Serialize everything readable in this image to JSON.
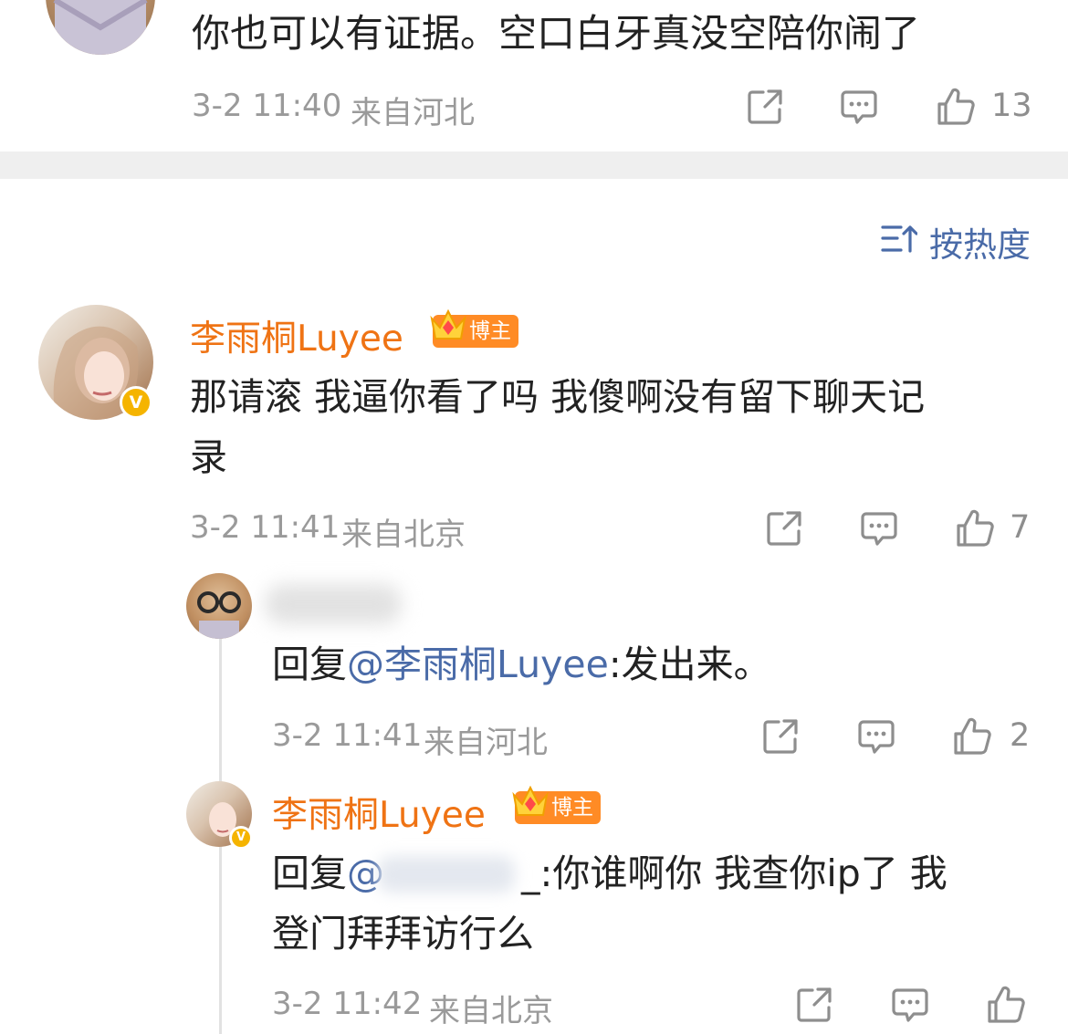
{
  "colors": {
    "accent": "#ef7314",
    "mention": "#4a6ba8",
    "meta": "#9a9a9a",
    "divider": "#efefef",
    "verified": "#f5b400"
  },
  "top_comment": {
    "text": "你也可以有证据。空口白牙真没空陪你闹了",
    "time": "3-2 11:40",
    "location": "来自河北",
    "likes": "13"
  },
  "sort": {
    "label": "按热度",
    "icon": "sort-icon"
  },
  "comments": [
    {
      "name": "李雨桐Luyee",
      "badge": "博主",
      "text_line1": "那请滚 我逼你看了吗 我傻啊没有留下聊天记",
      "text_line2": "录",
      "time": "3-2 11:41",
      "location": "来自北京",
      "likes": "7"
    }
  ],
  "replies": [
    {
      "prefix": "回复",
      "mention": "@李雨桐Luyee",
      "text": ":发出来。",
      "time": "3-2 11:41",
      "location": "来自河北",
      "likes": "2"
    },
    {
      "name": "李雨桐Luyee",
      "badge": "博主",
      "prefix": "回复",
      "mention": "@",
      "text_line1": "_:你谁啊你 我查你ip了 我",
      "text_line2": "登门拜拜访行么",
      "time": "3-2 11:42",
      "location": "来自北京",
      "likes": ""
    }
  ]
}
